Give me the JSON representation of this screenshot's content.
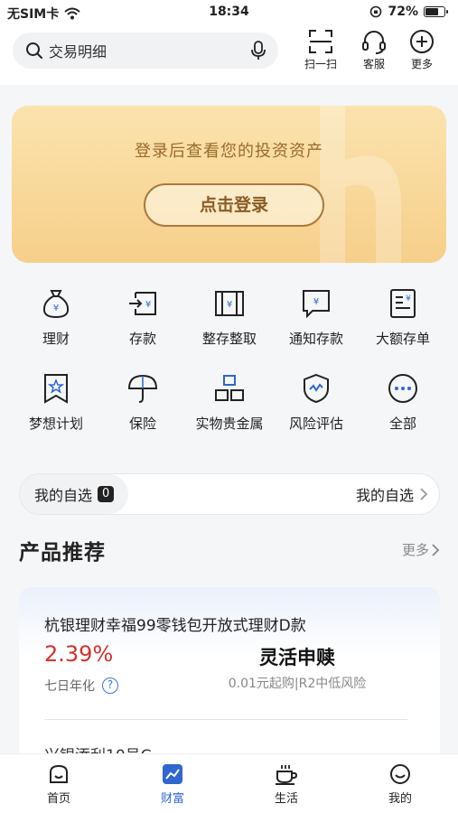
{
  "status_bar": {
    "carrier": "无SIM卡",
    "time": "18:34",
    "battery_percent": "72%",
    "battery_level": 0.72
  },
  "header": {
    "search_placeholder": "交易明细",
    "actions": [
      {
        "label": "扫一扫",
        "icon": "scan-icon"
      },
      {
        "label": "客服",
        "icon": "headset-icon"
      },
      {
        "label": "更多",
        "icon": "plus-circle-icon"
      }
    ]
  },
  "login_card": {
    "tip": "登录后查看您的投资资产",
    "button_label": "点击登录"
  },
  "features": [
    {
      "label": "理财",
      "icon": "money-bag-icon"
    },
    {
      "label": "存款",
      "icon": "deposit-icon"
    },
    {
      "label": "整存整取",
      "icon": "fixed-deposit-book-icon"
    },
    {
      "label": "通知存款",
      "icon": "notice-deposit-icon"
    },
    {
      "label": "大额存单",
      "icon": "large-certificate-icon"
    },
    {
      "label": "梦想计划",
      "icon": "dream-bookmark-icon"
    },
    {
      "label": "保险",
      "icon": "umbrella-icon"
    },
    {
      "label": "实物贵金属",
      "icon": "gold-bars-icon"
    },
    {
      "label": "风险评估",
      "icon": "shield-check-icon"
    },
    {
      "label": "全部",
      "icon": "more-dots-icon"
    }
  ],
  "favorites": {
    "left_label": "我的自选",
    "count": "0",
    "right_label": "我的自选"
  },
  "products": {
    "title": "产品推荐",
    "more_label": "更多",
    "items": [
      {
        "name": "杭银理财幸福99零钱包开放式理财D款",
        "rate": "2.39%",
        "rate_label": "七日年化",
        "mode": "灵活申赎",
        "meta": "0.01元起购|R2中低风险"
      }
    ],
    "next_item_partial": "兴银添利10号C"
  },
  "tabbar": {
    "tabs": [
      {
        "label": "首页",
        "icon": "home-icon",
        "active": false
      },
      {
        "label": "财富",
        "icon": "chart-icon",
        "active": true
      },
      {
        "label": "生活",
        "icon": "coffee-cup-icon",
        "active": false
      },
      {
        "label": "我的",
        "icon": "smiley-icon",
        "active": false
      }
    ]
  },
  "colors": {
    "accent_blue": "#2f66d0",
    "rate_red": "#d6302b",
    "gold_text": "#9a6a2c",
    "gold_card": "#f6cf8a"
  }
}
